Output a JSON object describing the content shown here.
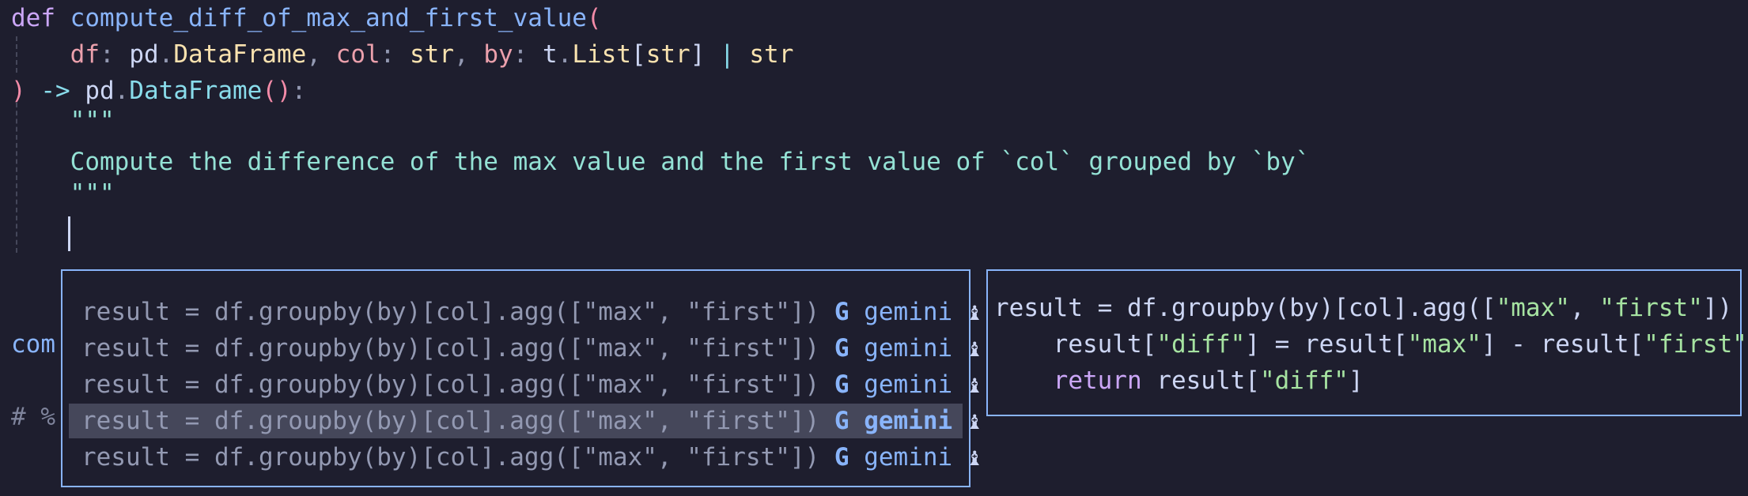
{
  "editor": {
    "code": {
      "def_kw": "def",
      "func_name": "compute_diff_of_max_and_first_value",
      "open_paren": "(",
      "indent": "    ",
      "p1": "df",
      "colon": ":",
      "p1_mod": "pd",
      "dot": ".",
      "p1_type": "DataFrame",
      "comma": ",",
      "p2": "col",
      "p2_type": "str",
      "p3": "by",
      "p3_mod": "t",
      "p3_type": "List",
      "p3_br_open": "[",
      "p3_inner": "str",
      "p3_br_close": "]",
      "pipe": "|",
      "p3_alt": "str",
      "close_paren": ")",
      "arrow": "->",
      "ret_mod": "pd",
      "ret_type": "DataFrame",
      "ret_call": "()",
      "ret_colon": ":",
      "doc_open": "\"\"\"",
      "doc_text": "Compute the difference of the max value and the first value of `col` grouped by `by`",
      "doc_close": "\"\"\""
    },
    "behind_popup": {
      "line_a": "com",
      "line_b": "# %"
    }
  },
  "completion_menu": {
    "items": [
      {
        "code": "result = df.groupby(by)[col].agg([\"max\", \"first\"])",
        "source_icon": "G",
        "source": "gemini",
        "tail_icon": "♝",
        "selected": false
      },
      {
        "code": "result = df.groupby(by)[col].agg([\"max\", \"first\"])",
        "source_icon": "G",
        "source": "gemini",
        "tail_icon": "♝",
        "selected": false
      },
      {
        "code": "result = df.groupby(by)[col].agg([\"max\", \"first\"])",
        "source_icon": "G",
        "source": "gemini",
        "tail_icon": "♝",
        "selected": false
      },
      {
        "code": "result = df.groupby(by)[col].agg([\"max\", \"first\"])",
        "source_icon": "G",
        "source": "gemini",
        "tail_icon": "♝",
        "selected": true
      },
      {
        "code": "result = df.groupby(by)[col].agg([\"max\", \"first\"])",
        "source_icon": "G",
        "source": "gemini",
        "tail_icon": "♝",
        "selected": false
      }
    ]
  },
  "preview": {
    "line1": {
      "a": "result = df.groupby(by)[col].agg([",
      "s1": "\"max\"",
      "b": ", ",
      "s2": "\"first\"",
      "c": "])"
    },
    "line2": {
      "indent": "    ",
      "a": "result[",
      "s1": "\"diff\"",
      "b": "] = result[",
      "s2": "\"max\"",
      "c": "] - result[",
      "s3": "\"first\"",
      "d": "]"
    },
    "line3": {
      "indent": "    ",
      "kw": "return",
      "a": " result[",
      "s1": "\"diff\"",
      "b": "]"
    }
  }
}
